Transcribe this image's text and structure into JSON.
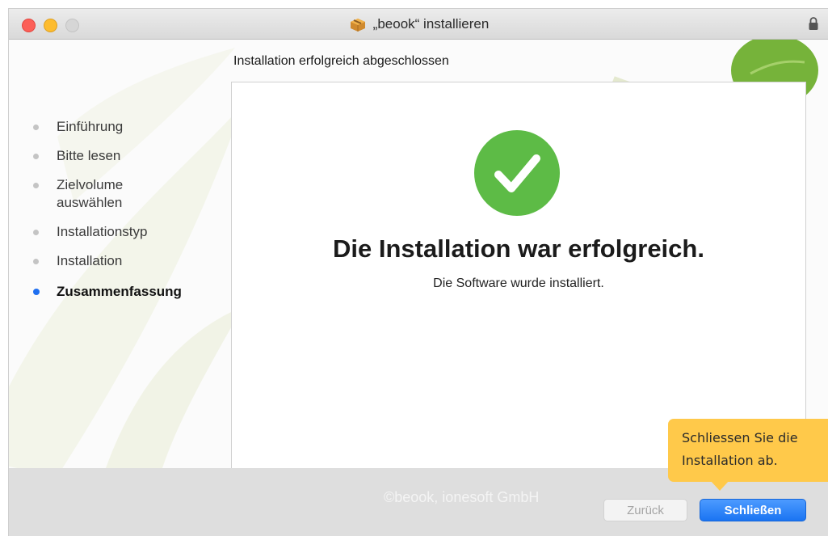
{
  "window": {
    "title": "„beook“ installieren"
  },
  "content": {
    "heading": "Installation erfolgreich abgeschlossen",
    "steps": [
      {
        "label": "Einführung",
        "active": false
      },
      {
        "label": "Bitte lesen",
        "active": false
      },
      {
        "label": "Zielvolume auswählen",
        "active": false
      },
      {
        "label": "Installationstyp",
        "active": false
      },
      {
        "label": "Installation",
        "active": false
      },
      {
        "label": "Zusammenfassung",
        "active": true
      }
    ],
    "success_title": "Die Installation war erfolgreich.",
    "success_subtitle": "Die Software wurde installiert."
  },
  "footer": {
    "copyright": "©beook, ionesoft GmbH",
    "back_label": "Zurück",
    "close_label": "Schließen"
  },
  "callout": {
    "text": "Schliessen Sie die Installation ab."
  },
  "colors": {
    "accent": "#1f6ff0",
    "success": "#5dbb46",
    "callout": "#ffc94a"
  }
}
